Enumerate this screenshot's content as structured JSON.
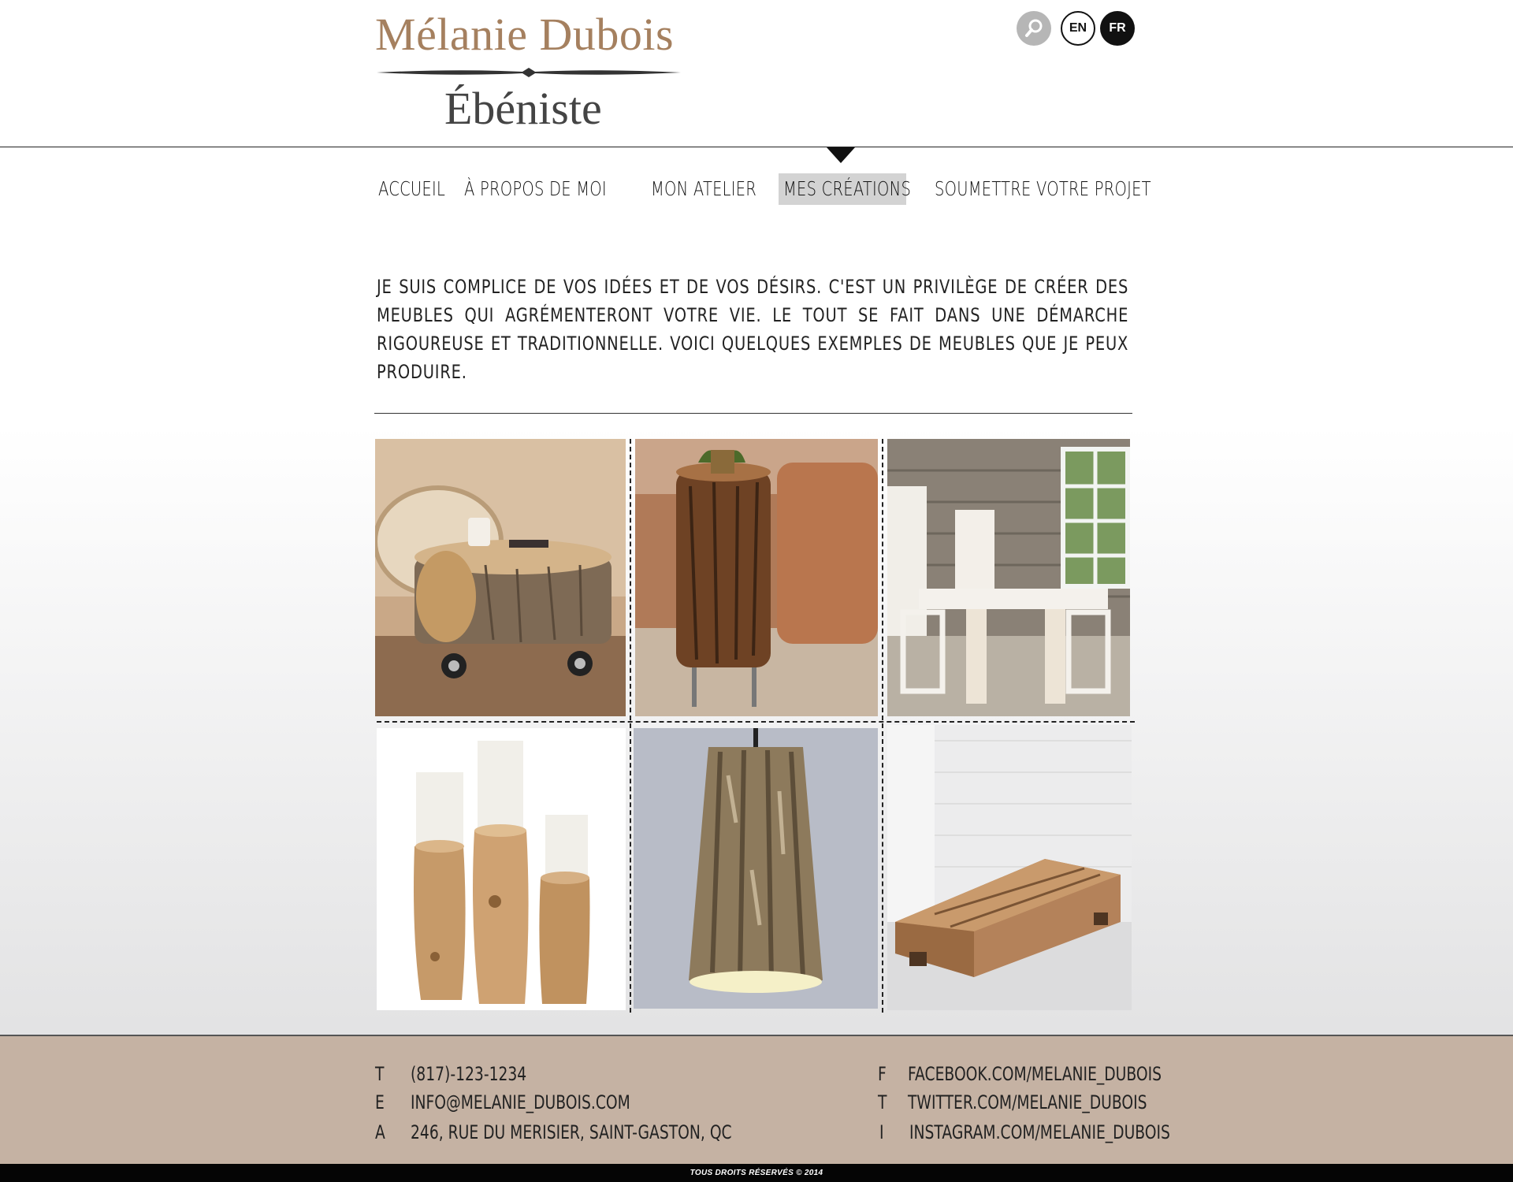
{
  "header": {
    "name": "Mélanie Dubois",
    "subtitle": "Ébéniste",
    "search_icon": "search-icon",
    "lang_en": "EN",
    "lang_fr": "FR",
    "brand_color": "#a5805f"
  },
  "nav": {
    "items": [
      {
        "label": "ACCUEIL"
      },
      {
        "label": "À PROPOS DE MOI"
      },
      {
        "label": "MON ATELIER"
      },
      {
        "label": "MES CRÉATIONS",
        "active": true
      },
      {
        "label": "SOUMETTRE VOTRE PROJET"
      }
    ]
  },
  "intro": {
    "text": "Je suis complice de vos idées et de vos désirs.  C'est un privilège de créer des meubles qui agrémenteront votre vie. Le tout se fait dans une démarche rigoureuse et traditionnelle. Voici quelques exemples de meubles que je peux produire."
  },
  "gallery": {
    "items": [
      {
        "subject": "log-coffee-table-on-casters"
      },
      {
        "subject": "tree-trunk-side-table"
      },
      {
        "subject": "stone-wall-dining-room"
      },
      {
        "subject": "wooden-candle-holders"
      },
      {
        "subject": "bark-pendant-lamp"
      },
      {
        "subject": "oak-beam-bench"
      }
    ]
  },
  "footer": {
    "contact": [
      {
        "key": "T",
        "value": "(817)-123-1234"
      },
      {
        "key": "E",
        "value": "INFO@MELANIE_DUBOIS.COM"
      },
      {
        "key": "A",
        "value": "246, RUE DU MERISIER, SAINT-GASTON, QC"
      }
    ],
    "social": [
      {
        "key": "F",
        "value": "FACEBOOK.COM/MELANIE_DUBOIS"
      },
      {
        "key": "T",
        "value": "TWITTER.COM/MELANIE_DUBOIS"
      },
      {
        "key": "I",
        "value": "INSTAGRAM.COM/MELANIE_DUBOIS"
      }
    ],
    "background_color": "#c5b2a3"
  },
  "copyright": "TOUS DROITS RÉSERVÉS © 2014"
}
